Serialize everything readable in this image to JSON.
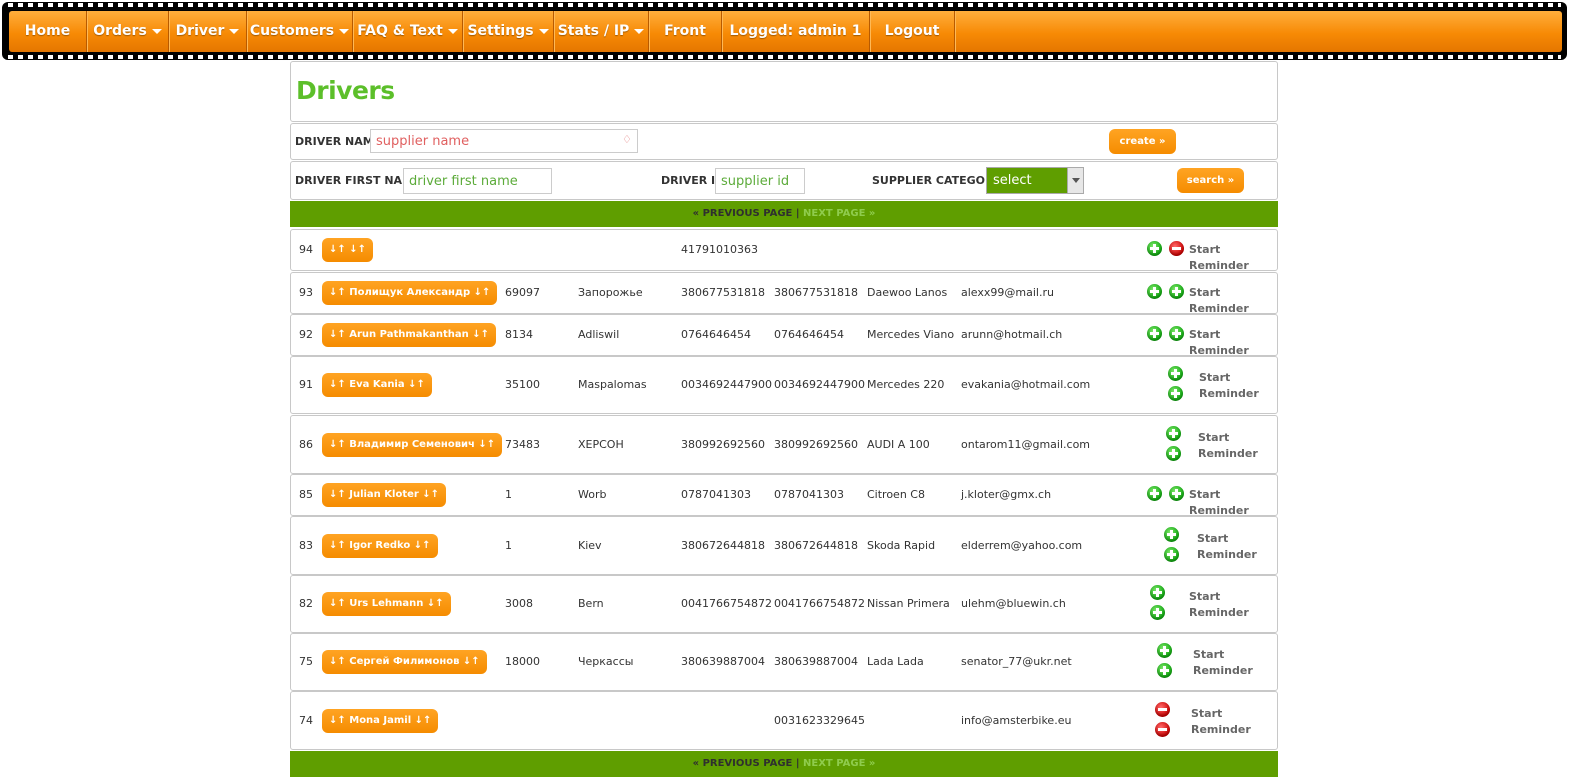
{
  "nav": {
    "items": [
      {
        "label": "Home",
        "caret": false
      },
      {
        "label": "Orders",
        "caret": true
      },
      {
        "label": "Driver",
        "caret": true
      },
      {
        "label": "Customers",
        "caret": true
      },
      {
        "label": "FAQ & Text",
        "caret": true
      },
      {
        "label": "Settings",
        "caret": true
      },
      {
        "label": "Stats / IP",
        "caret": true
      },
      {
        "label": "Front",
        "caret": false
      },
      {
        "label": "Logged: admin 1",
        "caret": false
      },
      {
        "label": "Logout",
        "caret": false
      }
    ]
  },
  "page": {
    "title": "Drivers"
  },
  "filters": {
    "driver_name_label": "DRIVER NAME",
    "driver_name_placeholder": "supplier name",
    "create_label": "create »",
    "driver_first_name_label": "DRIVER FIRST NAME",
    "driver_first_name_placeholder": "driver first name",
    "driver_id_label": "DRIVER ID",
    "driver_id_placeholder": "supplier id",
    "supplier_category_label": "SUPPLIER CATEGORY",
    "supplier_category_value": "select",
    "search_label": "search »"
  },
  "pager": {
    "prev": "« PREVIOUS PAGE",
    "sep": " | ",
    "next": "NEXT PAGE »"
  },
  "reminder": {
    "start": "Start",
    "reminder": "Reminder",
    "full": "Start Reminder"
  },
  "drivers": [
    {
      "id": "94",
      "name": "↓↑  ↓↑",
      "zip": "",
      "city": "",
      "phone1": "41791010363",
      "phone2": "",
      "car": "",
      "email": "",
      "icons": [
        "plus",
        "minus"
      ]
    },
    {
      "id": "93",
      "name": "↓↑ Полищук Александр ↓↑",
      "zip": "69097",
      "city": "Запорожье",
      "phone1": "380677531818",
      "phone2": "380677531818",
      "car": "Daewoo  Lanos",
      "email": "alexx99@mail.ru",
      "icons": [
        "plus",
        "plus"
      ]
    },
    {
      "id": "92",
      "name": "↓↑ Arun Pathmakanthan ↓↑",
      "zip": "8134",
      "city": "Adliswil",
      "phone1": "0764646454",
      "phone2": "0764646454",
      "car": "Mercedes  Viano",
      "email": "arunn@hotmail.ch",
      "icons": [
        "plus",
        "plus"
      ]
    },
    {
      "id": "91",
      "name": "↓↑ Eva  Kania ↓↑",
      "zip": "35100",
      "city": "Maspalomas",
      "phone1": "0034692447900",
      "phone2": "0034692447900",
      "car": "Mercedes  220",
      "email": "evakania@hotmail.com",
      "icons": [
        "plus",
        "plus"
      ]
    },
    {
      "id": "86",
      "name": "↓↑ Владимир Семенович ↓↑",
      "zip": "73483",
      "city": "ХЕРСОН",
      "phone1": "380992692560",
      "phone2": "380992692560",
      "car": "AUDI   A 100",
      "email": "ontarom11@gmail.com",
      "icons": [
        "plus",
        "plus"
      ]
    },
    {
      "id": "85",
      "name": "↓↑ Julian Kloter ↓↑",
      "zip": "1",
      "city": "Worb",
      "phone1": "0787041303",
      "phone2": "0787041303",
      "car": "Citroen  C8",
      "email": "j.kloter@gmx.ch",
      "icons": [
        "plus",
        "plus"
      ]
    },
    {
      "id": "83",
      "name": "↓↑ Igor Redko ↓↑",
      "zip": "1",
      "city": "Kiev",
      "phone1": "380672644818",
      "phone2": "380672644818",
      "car": "Skoda  Rapid",
      "email": "elderrem@yahoo.com",
      "icons": [
        "plus",
        "plus"
      ]
    },
    {
      "id": "82",
      "name": "↓↑ Urs Lehmann ↓↑",
      "zip": "3008",
      "city": "Bern",
      "phone1": "0041766754872",
      "phone2": "0041766754872",
      "car": "Nissan  Primera",
      "email": "ulehm@bluewin.ch",
      "icons": [
        "plus",
        "plus"
      ]
    },
    {
      "id": "75",
      "name": "↓↑ Сергей Филимонов ↓↑",
      "zip": "18000",
      "city": "Черкассы",
      "phone1": "380639887004",
      "phone2": "380639887004",
      "car": "Lada  Lada",
      "email": "senator_77@ukr.net",
      "icons": [
        "plus",
        "plus"
      ]
    },
    {
      "id": "74",
      "name": "↓↑ Mona Jamil ↓↑",
      "zip": "",
      "city": "",
      "phone1": "",
      "phone2": "0031623329645",
      "car": "",
      "email": "info@amsterbike.eu",
      "icons": [
        "minus",
        "minus"
      ]
    }
  ]
}
